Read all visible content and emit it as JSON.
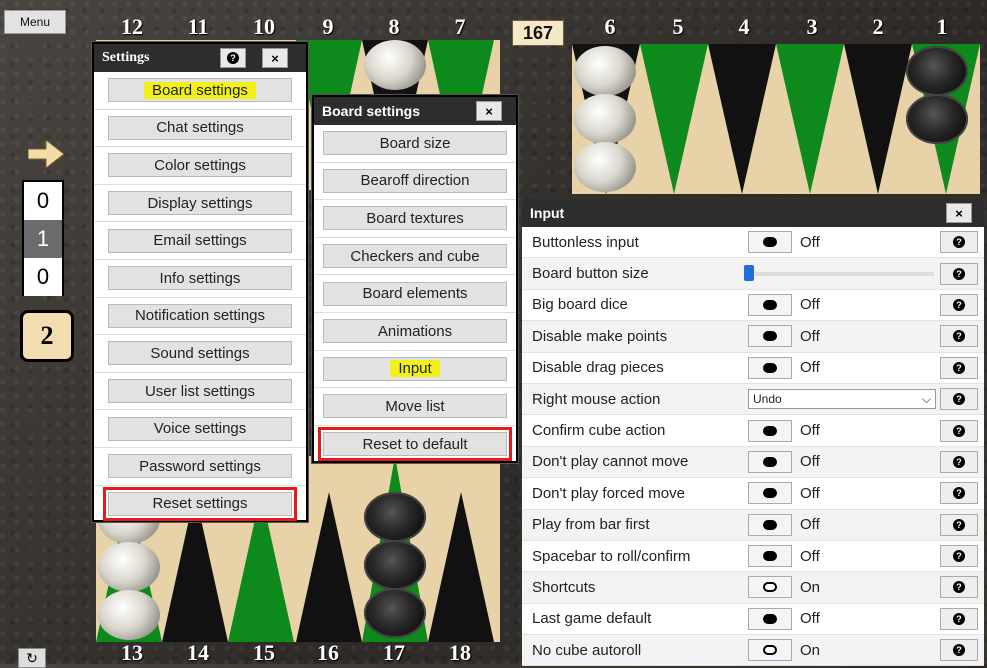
{
  "topbar": {
    "menu_label": "Menu",
    "top_points": [
      "12",
      "11",
      "10",
      "9",
      "8",
      "7",
      "6",
      "5",
      "4",
      "3",
      "2",
      "1"
    ],
    "bottom_points": [
      "13",
      "14",
      "15",
      "16",
      "17",
      "18"
    ],
    "pip_count": "167"
  },
  "side": {
    "cube_top": "0",
    "cube_mid": "1",
    "cube_bottom": "0",
    "dice_value": "2",
    "refresh_icon": "refresh-icon"
  },
  "colors": {
    "board_light": "#e8d2a8",
    "board_dark": "#111111",
    "board_green": "#0e8a1d",
    "highlight": "#f2f01a",
    "red_outline": "#e31b1b"
  },
  "settings_panel": {
    "title": "Settings",
    "help_icon": "?",
    "close_icon": "×",
    "items": [
      "Board settings",
      "Chat settings",
      "Color settings",
      "Display settings",
      "Email settings",
      "Info settings",
      "Notification settings",
      "Sound settings",
      "User list settings",
      "Voice settings",
      "Password settings",
      "Reset settings"
    ]
  },
  "board_settings_panel": {
    "title": "Board settings",
    "close_icon": "×",
    "items": [
      "Board size",
      "Bearoff direction",
      "Board textures",
      "Checkers and cube",
      "Board elements",
      "Animations",
      "Input",
      "Move list",
      "Reset to default"
    ]
  },
  "input_panel": {
    "title": "Input",
    "close_icon": "×",
    "rows": [
      {
        "label": "Buttonless input",
        "type": "toggle",
        "state": "Off"
      },
      {
        "label": "Board button size",
        "type": "slider",
        "value": 0
      },
      {
        "label": "Big board dice",
        "type": "toggle",
        "state": "Off"
      },
      {
        "label": "Disable make points",
        "type": "toggle",
        "state": "Off"
      },
      {
        "label": "Disable drag pieces",
        "type": "toggle",
        "state": "Off"
      },
      {
        "label": "Right mouse action",
        "type": "select",
        "state": "Undo"
      },
      {
        "label": "Confirm cube action",
        "type": "toggle",
        "state": "Off"
      },
      {
        "label": "Don't play cannot move",
        "type": "toggle",
        "state": "Off"
      },
      {
        "label": "Don't play forced move",
        "type": "toggle",
        "state": "Off"
      },
      {
        "label": "Play from bar first",
        "type": "toggle",
        "state": "Off"
      },
      {
        "label": "Spacebar to roll/confirm",
        "type": "toggle",
        "state": "Off"
      },
      {
        "label": "Shortcuts",
        "type": "toggle",
        "state": "On"
      },
      {
        "label": "Last game default",
        "type": "toggle",
        "state": "Off"
      },
      {
        "label": "No cube autoroll",
        "type": "toggle",
        "state": "On"
      }
    ]
  }
}
